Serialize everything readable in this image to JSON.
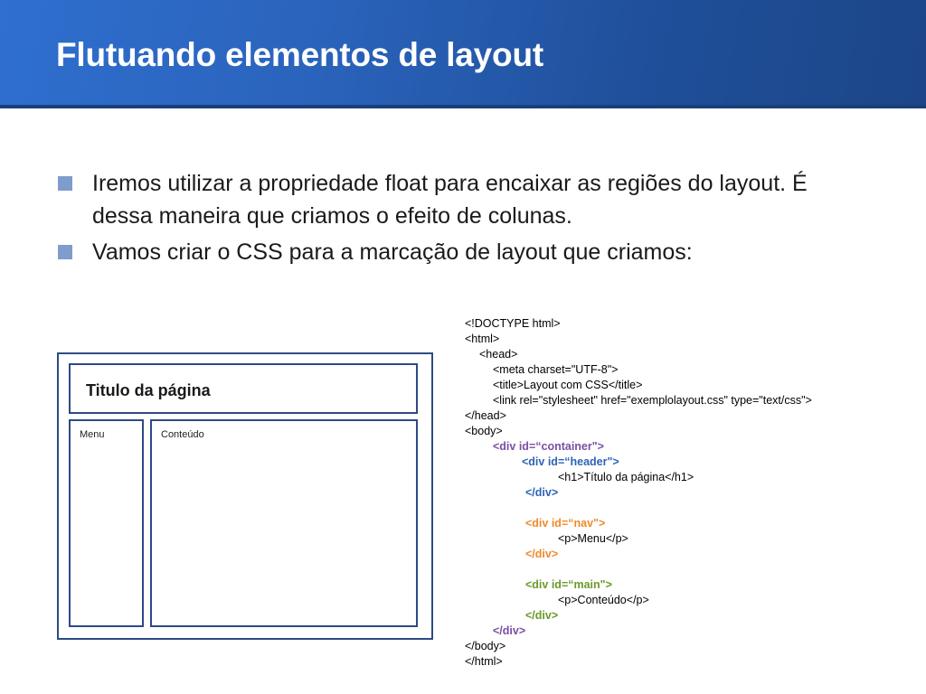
{
  "slide": {
    "title": "Flutuando elementos de layout",
    "bullets": [
      "Iremos utilizar a propriedade float para encaixar as regiões do layout. É dessa maneira que criamos o efeito de colunas.",
      "Vamos criar o CSS para a marcação de layout que criamos:"
    ]
  },
  "mockup": {
    "title": "Titulo da página",
    "nav_label": "Menu",
    "main_label": "Conteúdo"
  },
  "code": [
    "<!DOCTYPE html>",
    "<html>",
    "<head>",
    "<meta charset=\"UTF-8\">",
    "<title>Layout com CSS</title>",
    "<link rel=\"stylesheet\" href=\"exemplolayout.css\" type=\"text/css\">",
    "</head>",
    "<body>",
    "<div id=“container\">",
    "<div id=“header\">",
    "<h1>Título da página</h1>",
    "</div>",
    "",
    "<div id=“nav\">",
    "<p>Menu</p>",
    "</div>",
    "",
    "<div id=“main\">",
    "<p>Conteúdo</p>",
    "</div>",
    "</div>",
    "</body>",
    "</html>"
  ],
  "colors": {
    "header_gradient_start": "#2f6fcf",
    "header_gradient_end": "#1c4687",
    "bullet_marker": "#7f9ccc",
    "container_tag": "#7b4ea3",
    "header_tag": "#2e63b6",
    "nav_tag": "#ef8a2c",
    "main_tag": "#6a9a2a"
  }
}
